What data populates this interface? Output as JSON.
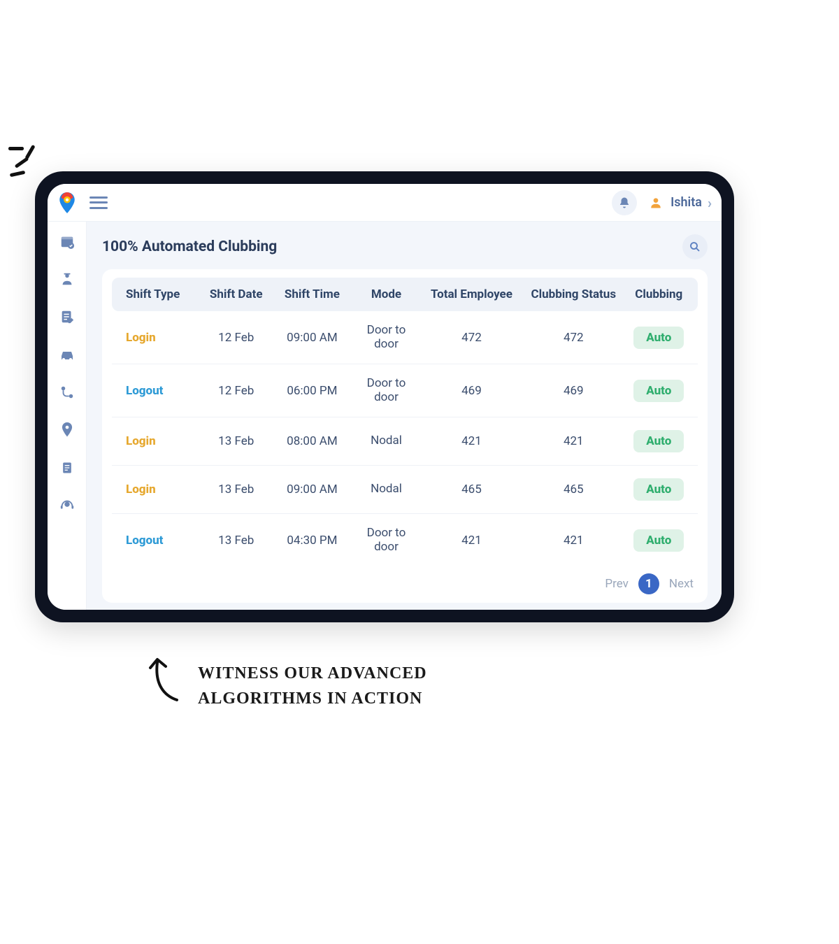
{
  "header": {
    "user_name": "Ishita"
  },
  "page": {
    "title": "100% Automated Clubbing"
  },
  "table": {
    "columns": {
      "shift_type": "Shift Type",
      "shift_date": "Shift Date",
      "shift_time": "Shift Time",
      "mode": "Mode",
      "total_employee": "Total Employee",
      "clubbing_status": "Clubbing Status",
      "clubbing": "Clubbing"
    },
    "rows": [
      {
        "shift_type": "Login",
        "shift_kind": "login",
        "shift_date": "12 Feb",
        "shift_time": "09:00 AM",
        "mode": "Door to door",
        "total_employee": "472",
        "clubbing_status": "472",
        "clubbing": "Auto"
      },
      {
        "shift_type": "Logout",
        "shift_kind": "logout",
        "shift_date": "12 Feb",
        "shift_time": "06:00 PM",
        "mode": "Door to door",
        "total_employee": "469",
        "clubbing_status": "469",
        "clubbing": "Auto"
      },
      {
        "shift_type": "Login",
        "shift_kind": "login",
        "shift_date": "13 Feb",
        "shift_time": "08:00 AM",
        "mode": "Nodal",
        "total_employee": "421",
        "clubbing_status": "421",
        "clubbing": "Auto"
      },
      {
        "shift_type": "Login",
        "shift_kind": "login",
        "shift_date": "13 Feb",
        "shift_time": "09:00 AM",
        "mode": "Nodal",
        "total_employee": "465",
        "clubbing_status": "465",
        "clubbing": "Auto"
      },
      {
        "shift_type": "Logout",
        "shift_kind": "logout",
        "shift_date": "13 Feb",
        "shift_time": "04:30 PM",
        "mode": "Door to door",
        "total_employee": "421",
        "clubbing_status": "421",
        "clubbing": "Auto"
      }
    ]
  },
  "pagination": {
    "prev": "Prev",
    "next": "Next",
    "current": "1"
  },
  "caption": {
    "line1": "Witness our advanced",
    "line2": "algorithms in action"
  },
  "icons": {
    "bell": "bell-icon",
    "avatar": "person-icon",
    "search": "search-icon",
    "sidebar": [
      "calendar-check-icon",
      "guard-icon",
      "form-edit-icon",
      "car-icon",
      "route-pin-icon",
      "map-pin-icon",
      "report-icon",
      "support-agent-icon"
    ]
  },
  "colors": {
    "accent_blue": "#3a67c5",
    "login": "#e6a82f",
    "logout": "#2f9bd6",
    "auto_bg": "#dff2e7",
    "auto_fg": "#2fae6e"
  }
}
